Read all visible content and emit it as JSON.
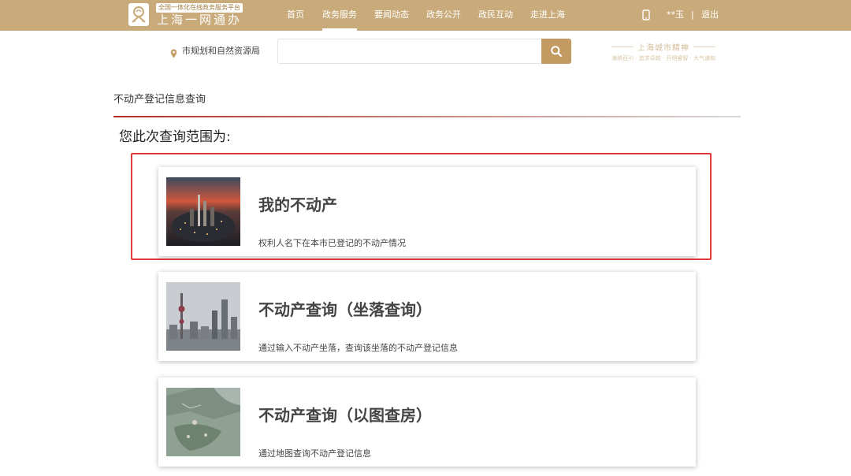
{
  "header": {
    "logo_tag": "全国一体化在线政务服务平台",
    "logo_title": "上海一网通办",
    "nav": [
      {
        "label": "首页"
      },
      {
        "label": "政务服务"
      },
      {
        "label": "要闻动态"
      },
      {
        "label": "政务公开"
      },
      {
        "label": "政民互动"
      },
      {
        "label": "走进上海"
      }
    ],
    "active_nav": "政务服务",
    "user_name": "**玉",
    "separator": "|",
    "logout": "退出",
    "bar_color": "#c9ab7b"
  },
  "search": {
    "location": "市规划和自然资源局",
    "value": "",
    "placeholder": "",
    "button_color": "#c49a63"
  },
  "brand": {
    "title": "上海城市精神",
    "subtitle": "海纳百川 · 追求卓越 · 开明睿智 · 大气谦和"
  },
  "page": {
    "title": "不动产登记信息查询",
    "scope_label": "您此次查询范围为:"
  },
  "cards": [
    {
      "title": "我的不动产",
      "desc": "权利人名下在本市已登记的不动产情况",
      "thumb": "city-night-photo",
      "selected": true
    },
    {
      "title": "不动产查询（坐落查询）",
      "desc": "通过输入不动产坐落，查询该坐落的不动产登记信息",
      "thumb": "skyline-photo",
      "selected": false
    },
    {
      "title": "不动产查询（以图查房）",
      "desc": "通过地图查询不动产登记信息",
      "thumb": "satellite-map",
      "selected": false
    }
  ],
  "colors": {
    "highlight_border": "#e03a3a",
    "title_rule": "#b22a2a"
  }
}
